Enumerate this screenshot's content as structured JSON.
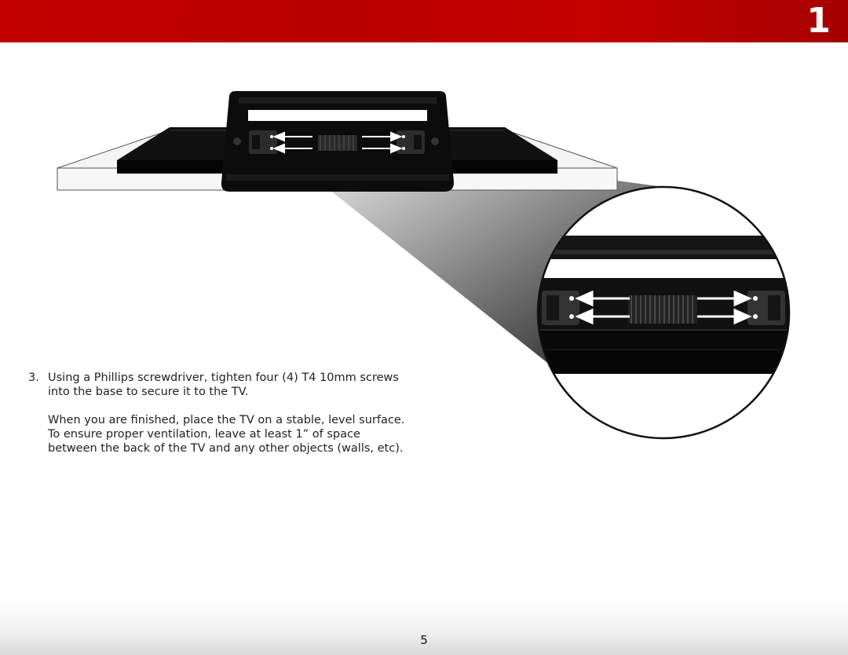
{
  "header": {
    "chapter_number": "1",
    "accent_color": "#c00000"
  },
  "instructions": {
    "step_number": "3.",
    "step_text": "Using a Phillips screwdriver, tighten four (4) T4 10mm screws into the base to secure it to the TV.",
    "note_text": "When you are finished, place the TV on a stable, level surface. To ensure proper ventilation, leave at least 1” of space between the back of the TV and any other objects (walls, etc)."
  },
  "footer": {
    "page_number": "5"
  }
}
